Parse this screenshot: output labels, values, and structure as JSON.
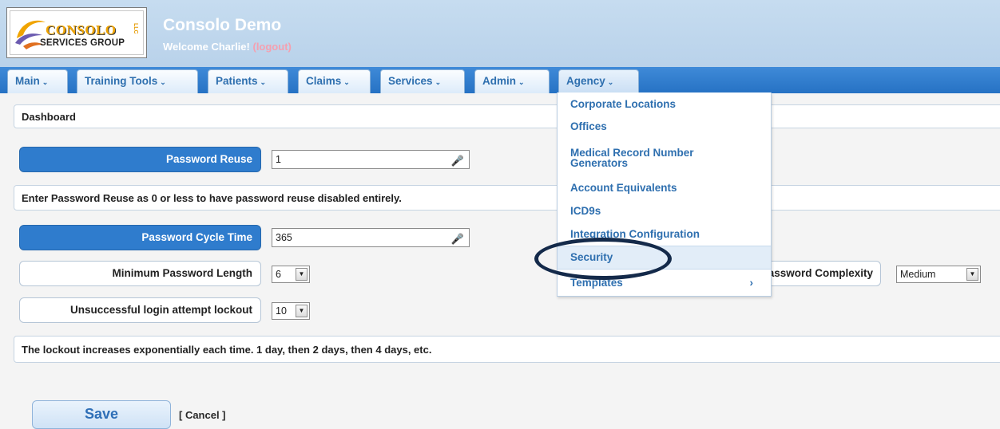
{
  "header": {
    "logo_line1": "CONSOLO",
    "logo_llc": "LLC",
    "logo_line2": "SERVICES GROUP",
    "title": "Consolo Demo",
    "welcome_prefix": "Welcome Charlie!",
    "logout_label": "(logout)"
  },
  "nav": {
    "tabs": [
      {
        "label": "Main"
      },
      {
        "label": "Training Tools"
      },
      {
        "label": "Patients"
      },
      {
        "label": "Claims"
      },
      {
        "label": "Services"
      },
      {
        "label": "Admin"
      },
      {
        "label": "Agency"
      }
    ],
    "caret": "⌄"
  },
  "page": {
    "section_title": "Dashboard",
    "password_reuse": {
      "label": "Password Reuse",
      "value": "1"
    },
    "reuse_note": "Enter Password Reuse as 0 or less to have password reuse disabled entirely.",
    "password_cycle": {
      "label": "Password Cycle Time",
      "value": "365"
    },
    "min_length": {
      "label": "Minimum Password Length",
      "value": "6"
    },
    "complexity": {
      "label": "Password Complexity",
      "value": "Medium"
    },
    "lockout": {
      "label": "Unsuccessful login attempt lockout",
      "value": "10"
    },
    "lockout_note": "The lockout increases exponentially each time. 1 day, then 2 days, then 4 days, etc.",
    "save_label": "Save",
    "cancel_label": "[ Cancel ]"
  },
  "agency_menu": {
    "items": [
      {
        "label": "Corporate Locations"
      },
      {
        "label": "Offices"
      },
      {
        "label": "Medical Record Number\nGenerators"
      },
      {
        "label": "Account Equivalents"
      },
      {
        "label": "ICD9s"
      },
      {
        "label": "Integration Configuration"
      },
      {
        "label": "Security"
      },
      {
        "label": "Templates"
      }
    ],
    "submenu_chevron": "›"
  },
  "colors": {
    "nav_blue": "#2f7ccd",
    "link_blue": "#2e6faf",
    "highlight": "#e2edf8",
    "annotation": "#142a4a"
  },
  "icons": {
    "mic": "microphone-icon",
    "select_arrow": "triangle-down-icon"
  }
}
